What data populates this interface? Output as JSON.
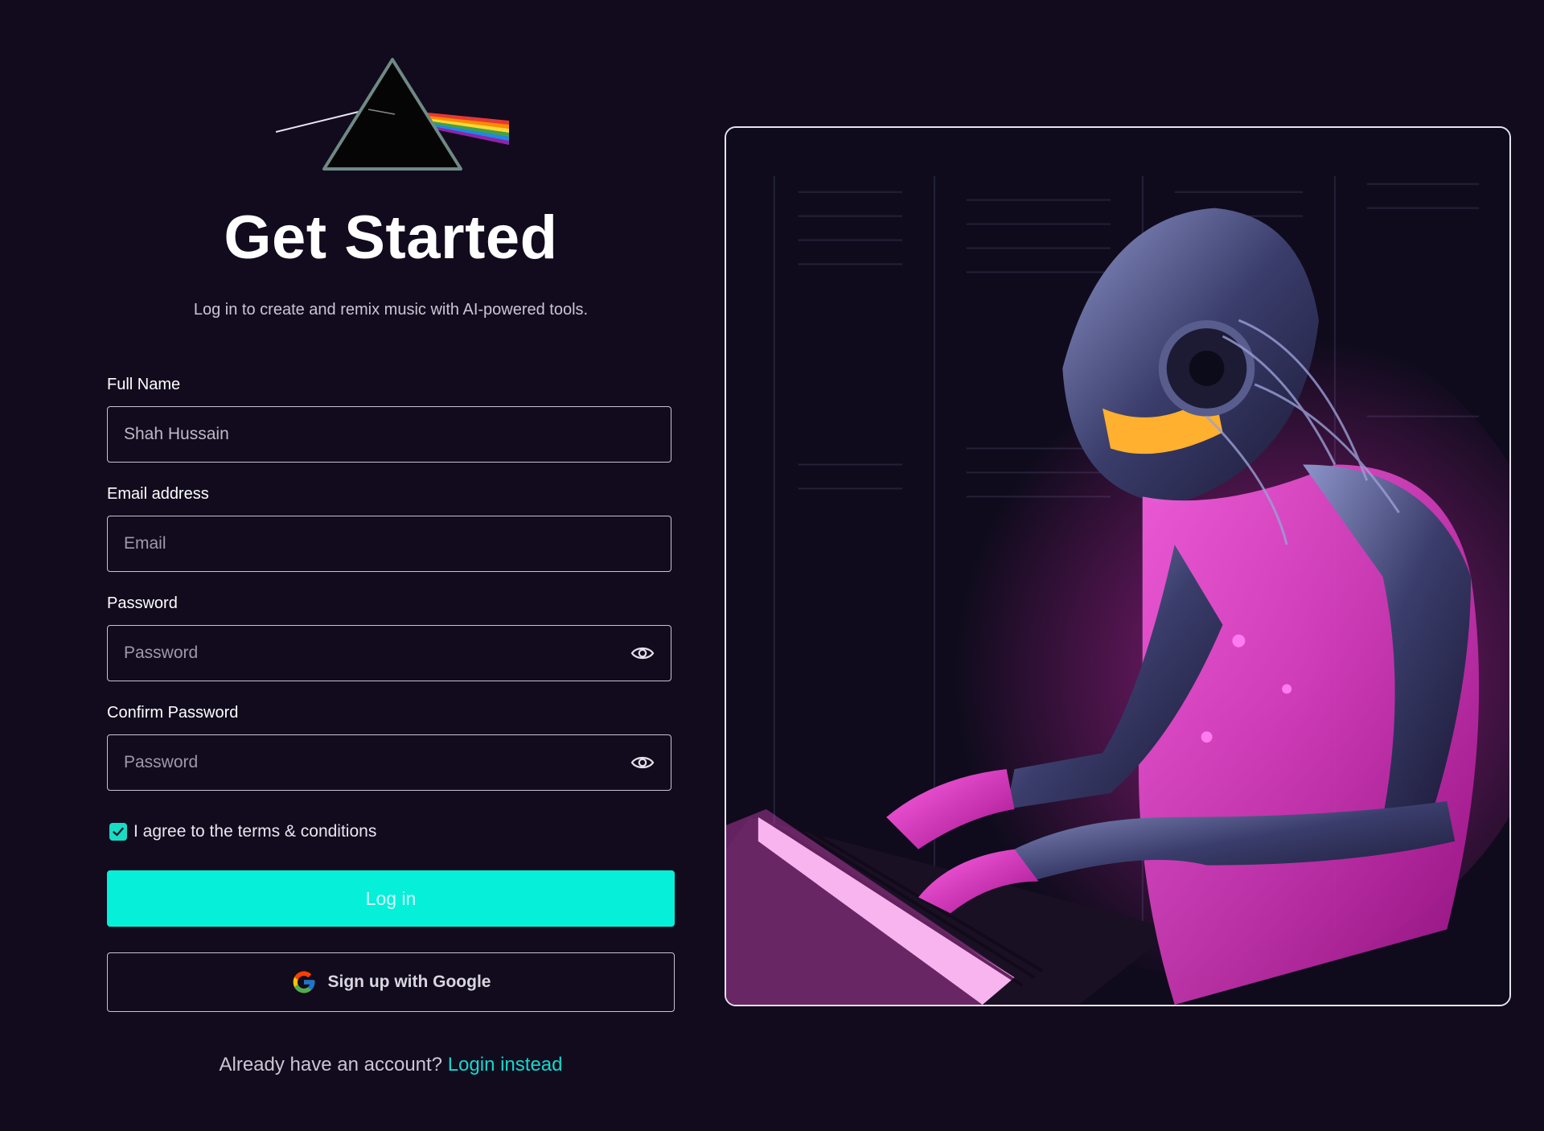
{
  "header": {
    "title": "Get Started",
    "subtitle": "Log in to create and remix music with AI-powered tools."
  },
  "form": {
    "full_name": {
      "label": "Full Name",
      "value": "Shah Hussain"
    },
    "email": {
      "label": "Email address",
      "placeholder": "Email"
    },
    "password": {
      "label": "Password",
      "placeholder": "Password"
    },
    "confirm_password": {
      "label": "Confirm Password",
      "placeholder": "Password"
    },
    "terms": {
      "label": "I agree to the terms & conditions",
      "checked": true
    },
    "login_button": "Log in",
    "google_button": "Sign up with Google"
  },
  "footer": {
    "prompt": "Already have an account?",
    "link": "Login instead"
  },
  "icons": {
    "logo": "prism-logo-icon",
    "eye": "eye-icon",
    "check": "check-icon",
    "google": "google-logo-icon"
  },
  "colors": {
    "background": "#120b1e",
    "accent": "#06efd9",
    "link": "#11d9cc",
    "input_border": "#c7c4cf"
  }
}
